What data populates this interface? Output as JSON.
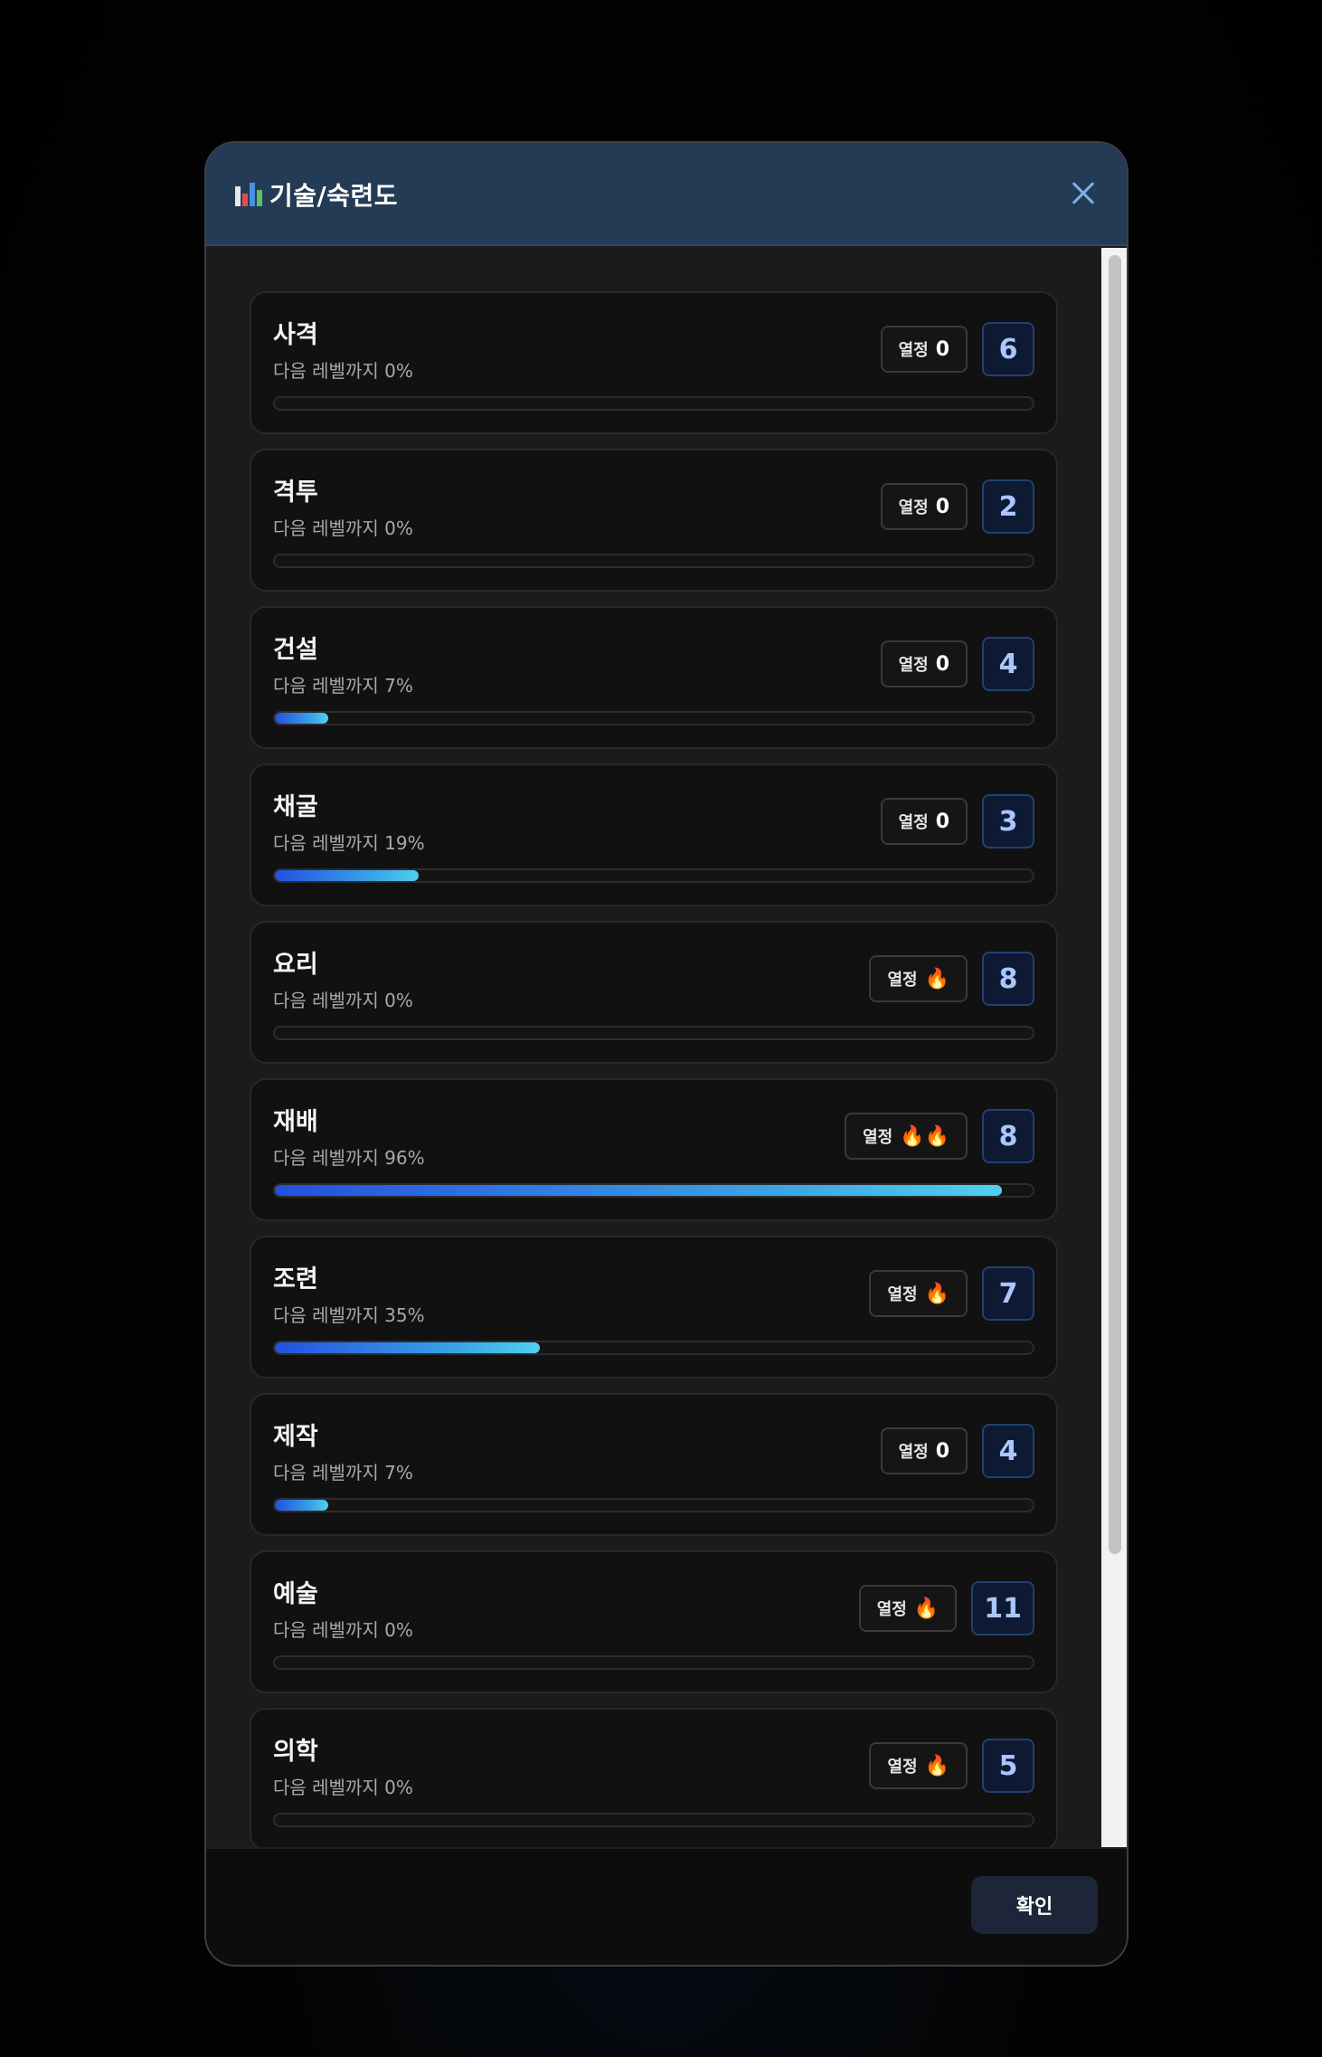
{
  "header": {
    "icon": "bar-chart-icon",
    "title": "기술/숙련도",
    "close_icon": "close-icon"
  },
  "progress_prefix": "다음 레벨까지",
  "passion_label": "열정",
  "skills": [
    {
      "name": "사격",
      "progress_text": "다음 레벨까지 0%",
      "progress": 0,
      "passion": "0",
      "level": "6"
    },
    {
      "name": "격투",
      "progress_text": "다음 레벨까지 0%",
      "progress": 0,
      "passion": "0",
      "level": "2"
    },
    {
      "name": "건설",
      "progress_text": "다음 레벨까지 7%",
      "progress": 7,
      "passion": "0",
      "level": "4"
    },
    {
      "name": "채굴",
      "progress_text": "다음 레벨까지 19%",
      "progress": 19,
      "passion": "0",
      "level": "3"
    },
    {
      "name": "요리",
      "progress_text": "다음 레벨까지 0%",
      "progress": 0,
      "passion": "🔥",
      "level": "8"
    },
    {
      "name": "재배",
      "progress_text": "다음 레벨까지 96%",
      "progress": 96,
      "passion": "🔥🔥",
      "level": "8"
    },
    {
      "name": "조련",
      "progress_text": "다음 레벨까지 35%",
      "progress": 35,
      "passion": "🔥",
      "level": "7"
    },
    {
      "name": "제작",
      "progress_text": "다음 레벨까지 7%",
      "progress": 7,
      "passion": "0",
      "level": "4"
    },
    {
      "name": "예술",
      "progress_text": "다음 레벨까지 0%",
      "progress": 0,
      "passion": "🔥",
      "level": "11"
    },
    {
      "name": "의학",
      "progress_text": "다음 레벨까지 0%",
      "progress": 0,
      "passion": "🔥",
      "level": "5"
    }
  ],
  "footer": {
    "confirm_label": "확인"
  },
  "colors": {
    "header_bg": "#243b55",
    "progress_start": "#2450e0",
    "progress_end": "#4fd0f0",
    "level_text": "#a9c6ff"
  }
}
